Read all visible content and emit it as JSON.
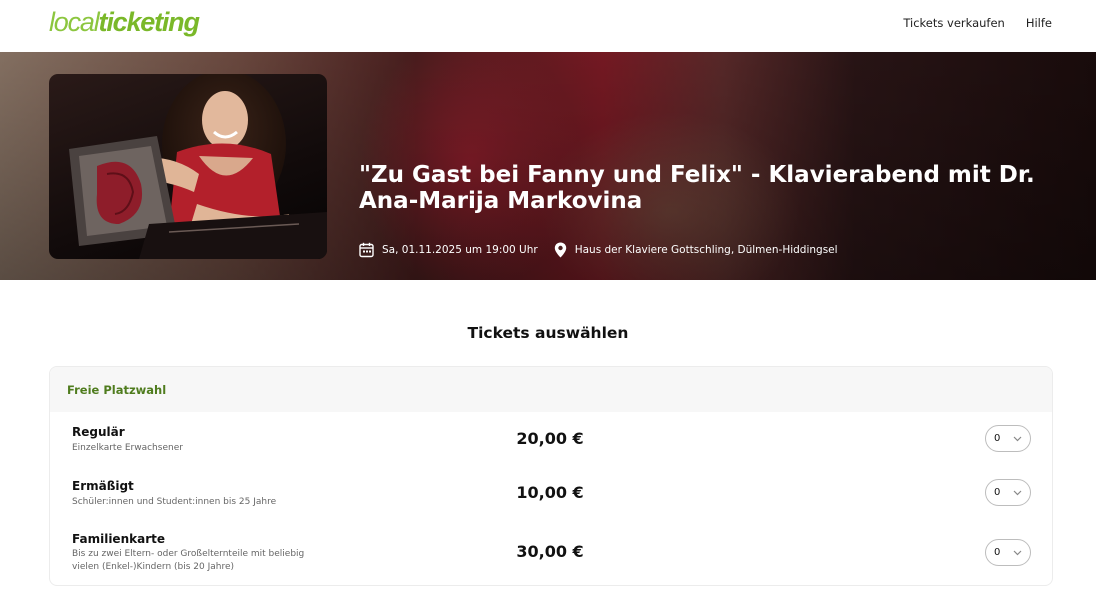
{
  "header": {
    "logo_part1": "local",
    "logo_part2": "ticketing",
    "nav": [
      "Tickets verkaufen",
      "Hilfe"
    ]
  },
  "event": {
    "title": "\"Zu Gast bei Fanny und Felix\" - Klavierabend mit Dr. Ana-Marija Markovina",
    "date": "Sa, 01.11.2025 um 19:00 Uhr",
    "venue": "Haus der Klaviere Gottschling, Dülmen-Hiddingsel",
    "date_icon": "calendar-icon",
    "venue_icon": "location-pin-icon"
  },
  "tickets": {
    "heading": "Tickets auswählen",
    "category": "Freie Platzwahl",
    "items": [
      {
        "name": "Regulär",
        "description": "Einzelkarte Erwachsener",
        "price": "20,00 €",
        "quantity": "0"
      },
      {
        "name": "Ermäßigt",
        "description": "Schüler:innen und Student:innen bis 25 Jahre",
        "price": "10,00 €",
        "quantity": "0"
      },
      {
        "name": "Familienkarte",
        "description": "Bis zu zwei Eltern- oder Großelternteile mit beliebig vielen (Enkel-)Kindern (bis 20 Jahre)",
        "price": "30,00 €",
        "quantity": "0"
      }
    ]
  },
  "colors": {
    "brand_green": "#7ab829",
    "category_green": "#4f7c1e"
  }
}
